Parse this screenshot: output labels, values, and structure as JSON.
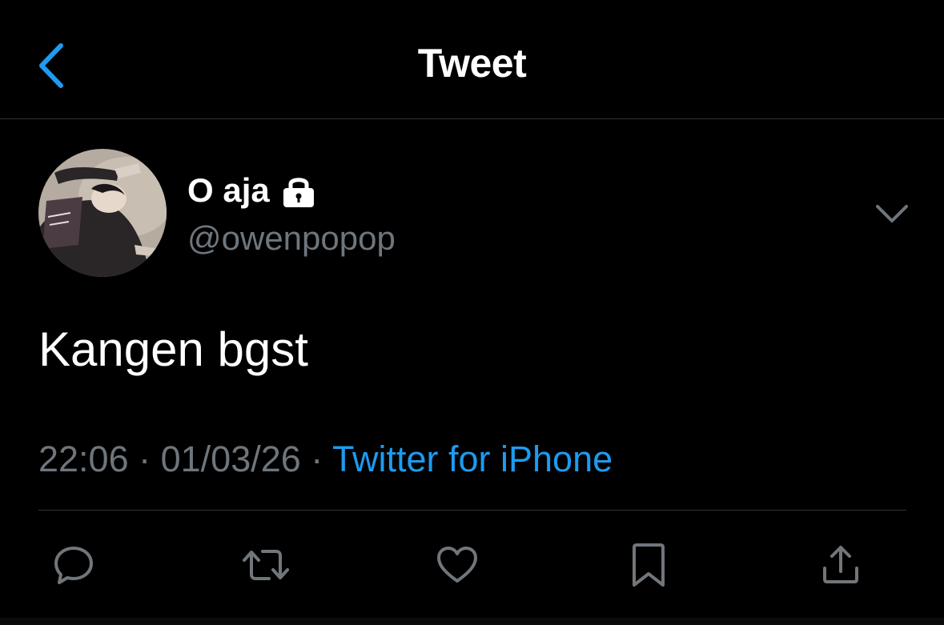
{
  "header": {
    "title": "Tweet",
    "back_icon": "chevron-left-icon"
  },
  "author": {
    "display_name": "O aja",
    "username": "@owenpopop",
    "protected_icon": "lock-icon"
  },
  "tweet": {
    "text": "Kangen bgst",
    "time": "22:06",
    "separator": " · ",
    "date": "01/03/26",
    "source": "Twitter for iPhone"
  },
  "actions": [
    {
      "name": "reply",
      "icon": "reply-icon"
    },
    {
      "name": "retweet",
      "icon": "retweet-icon"
    },
    {
      "name": "like",
      "icon": "heart-icon"
    },
    {
      "name": "bookmark",
      "icon": "bookmark-icon"
    },
    {
      "name": "share",
      "icon": "share-icon"
    }
  ],
  "colors": {
    "background": "#000000",
    "accent": "#1d9bf0",
    "secondary_text": "#6e767d",
    "divider": "#2f3336",
    "icon": "#71767b"
  }
}
